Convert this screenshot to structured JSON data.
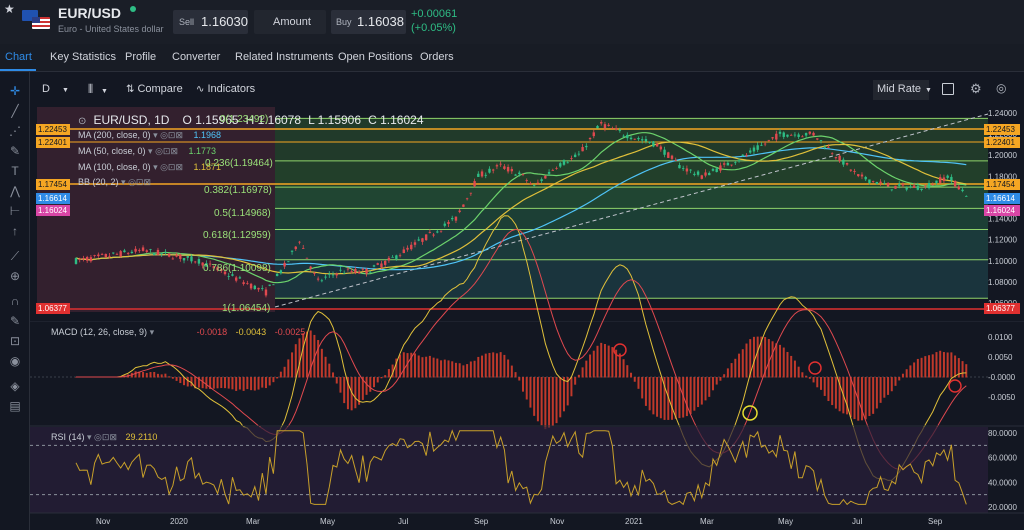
{
  "header": {
    "symbol": "EUR/USD",
    "name": "Euro - United States dollar",
    "sell_label": "Sell",
    "sell_price": "1.16030",
    "amount_label": "Amount",
    "buy_label": "Buy",
    "buy_price": "1.16038",
    "change": "+0.00061",
    "change_pct": "(+0.05%)"
  },
  "tabs": [
    "Chart",
    "Key Statistics",
    "Profile",
    "Converter",
    "Related Instruments",
    "Open Positions",
    "Orders"
  ],
  "toolbar": {
    "interval": "D",
    "compare": "Compare",
    "indicators": "Indicators",
    "rate": "Mid Rate"
  },
  "legend": {
    "symbol": "EUR/USD, 1D",
    "open": "O 1.15965",
    "high": "H 1.16078",
    "low": "L 1.15906",
    "close": "C 1.16024",
    "ma200": "MA (200, close, 0)",
    "ma200_val": "1.1968",
    "ma50": "MA (50, close, 0)",
    "ma50_val": "1.1773",
    "ma100": "MA (100, close, 0)",
    "ma100_val": "1.1871",
    "bb": "BB (20, 2)"
  },
  "fib_labels": [
    "0(1.23492)",
    "0.236(1.19464)",
    "0.382(1.16978)",
    "0.5(1.14968)",
    "0.618(1.12959)",
    "0.786(1.10098)",
    "1(1.06454)"
  ],
  "price_axis": [
    "1.24000",
    "1.22000",
    "1.20000",
    "1.18000",
    "1.16000",
    "1.14000",
    "1.12000",
    "1.10000",
    "1.08000",
    "1.06000"
  ],
  "price_tags": {
    "left": [
      "1.22453",
      "1.22401",
      "1.17454",
      "1.16614",
      "1.16024",
      "1.06377"
    ],
    "right": [
      "1.22453",
      "1.22401",
      "1.17454",
      "1.16614",
      "1.16024",
      "1.06377"
    ]
  },
  "macd": {
    "label": "MACD (12, 26, close, 9)",
    "v1": "-0.0018",
    "v2": "-0.0043",
    "v3": "-0.0025",
    "axis": [
      "0.0100",
      "0.0050",
      "-0.0000",
      "-0.0050"
    ]
  },
  "rsi": {
    "label": "RSI (14)",
    "value": "29.2110",
    "axis": [
      "80.0000",
      "60.0000",
      "40.0000",
      "20.0000"
    ]
  },
  "time_axis": [
    "Nov",
    "2020",
    "Mar",
    "May",
    "Jul",
    "Sep",
    "Nov",
    "2021",
    "Mar",
    "May",
    "Jul",
    "Sep"
  ],
  "colors": {
    "up": "#2ebd85",
    "down": "#e0494f",
    "accent": "#2f8be6",
    "fib_band": "#2a8a3e",
    "macd_line": "#e0c03a",
    "rsi_line": "#c8a02a"
  }
}
